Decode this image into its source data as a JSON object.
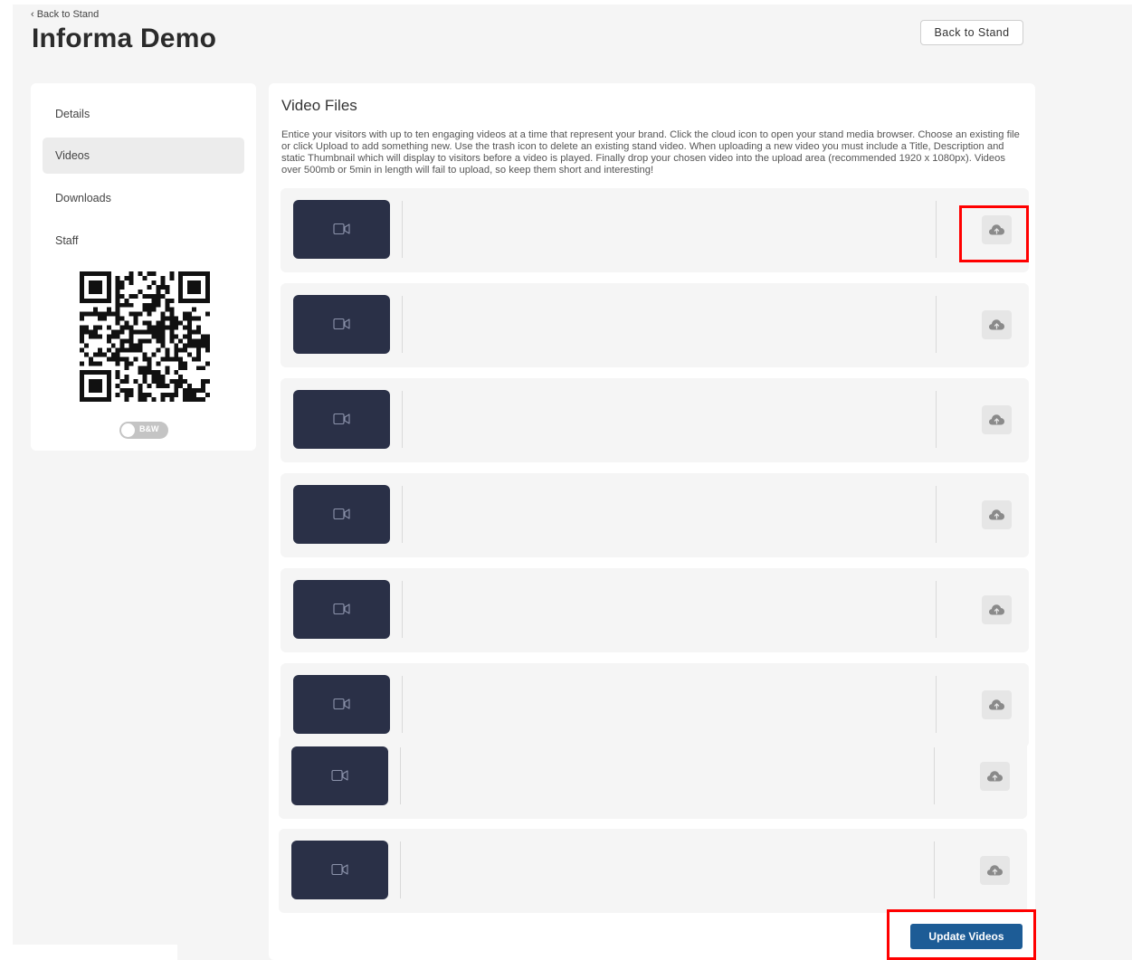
{
  "header": {
    "back_link": "‹ Back to Stand",
    "title": "Informa Demo",
    "back_button": "Back to Stand"
  },
  "sidebar": {
    "items": [
      {
        "label": "Details"
      },
      {
        "label": "Videos"
      },
      {
        "label": "Downloads"
      },
      {
        "label": "Staff"
      }
    ],
    "active_item": "Videos",
    "qr_icon": "qr-code",
    "toggle_label": "B&W"
  },
  "main": {
    "title": "Video Files",
    "description": "Entice your visitors with up to ten engaging videos at a time that represent your brand. Click the cloud icon to open your stand media browser. Choose an existing file or click Upload to add something new. Use the trash icon to delete an existing stand video. When uploading a new video you must include a Title, Description and static Thumbnail which will display to visitors before a video is played. Finally drop your chosen video into the upload area (recommended 1920 x 1080px). Videos over 500mb or 5min in length will fail to upload, so keep them short and interesting!",
    "video_row_count": 8,
    "thumbnail_icon": "video-camera-icon",
    "upload_icon": "cloud-upload-icon",
    "update_button": "Update Videos"
  },
  "colors": {
    "thumbnail": "#2a3047",
    "primary_button": "#1d5c96",
    "highlight": "#ff0000",
    "page_background": "#f5f5f5"
  }
}
